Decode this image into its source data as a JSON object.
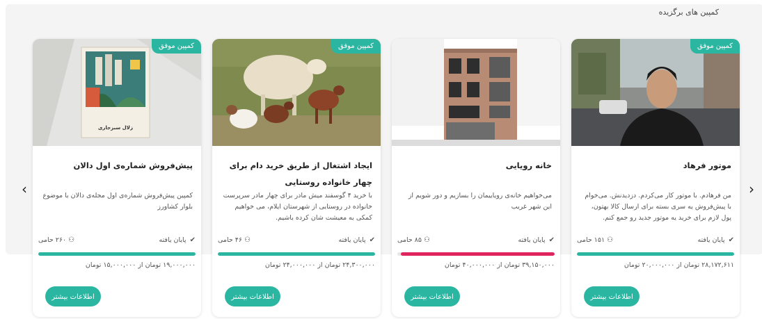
{
  "section": {
    "title": "کمپین های برگزیده"
  },
  "nav": {
    "prev_glyph": "‹",
    "next_glyph": "›"
  },
  "colors": {
    "accent": "#2bb6a2",
    "progress_partial": "#e0245e",
    "band": "#f4f4f4"
  },
  "cards": [
    {
      "badge": "کمپین موفق",
      "title": "موتور فرهاد",
      "description": "من فرهادم. با موتور کار می‌کردم. دزدیدنش. می‌خوام با پیش‌فروش یه سری بسته برای ارسال کالا بهتون، پول لازم برای خرید یه موتور جدید رو جمع کنم.",
      "status": "پایان یافته",
      "backers": "۱۵۱ حامی",
      "raised": "۲۸,۱۷۲,۶۱۱",
      "goal_text": "تومان از ۲۰,۰۰۰,۰۰۰ تومان",
      "progress": 1.0,
      "more_label": "اطلاعات بیشتر",
      "icons": {
        "status": "check-icon",
        "backers": "person-icon"
      }
    },
    {
      "badge": "",
      "title": "خانه رویایی",
      "description": "می‌خواهیم خانه‌ی رویاییمان را بسازیم و دور شویم از این شهر غریب",
      "status": "پایان یافته",
      "backers": "۸۵ حامی",
      "raised": "۳۹,۱۵۰,۰۰۰",
      "goal_text": "تومان از ۴۰,۰۰۰,۰۰۰ تومان",
      "progress": 0.979,
      "more_label": "اطلاعات بیشتر",
      "icons": {
        "status": "check-icon",
        "backers": "person-icon"
      }
    },
    {
      "badge": "کمپین موفق",
      "title": "ایجاد اشتغال از طریق خرید دام برای چهار خانواده روستایی",
      "description": "با خرید ۴ گوسفند میش مادر برای چهار مادر سرپرست خانواده در روستایی از شهرستان ایلام، می خواهیم کمکی به معیشت شان کرده باشیم.",
      "status": "پایان یافته",
      "backers": "۴۶ حامی",
      "raised": "۲۴,۳۰۰,۰۰۰",
      "goal_text": "تومان از ۲۴,۰۰۰,۰۰۰ تومان",
      "progress": 1.0,
      "more_label": "اطلاعات بیشتر",
      "icons": {
        "status": "check-icon",
        "backers": "person-icon"
      }
    },
    {
      "badge": "کمپین موفق",
      "title": "پیش‌فروش شماره‌ی اول دالان",
      "description": "کمپین پیش‌فروش شماره‌ی اول مجله‌ی دالان با موضوع بلوار کشاورز",
      "status": "پایان یافته",
      "backers": "۲۶۰ حامی",
      "raised": "۱۹,۰۰۰,۰۰۰",
      "goal_text": "تومان از ۱۵,۰۰۰,۰۰۰ تومان",
      "progress": 1.0,
      "more_label": "اطلاعات بیشتر",
      "book_cover_text": "زلال سبزجاری",
      "icons": {
        "status": "check-icon",
        "backers": "person-icon"
      }
    }
  ]
}
